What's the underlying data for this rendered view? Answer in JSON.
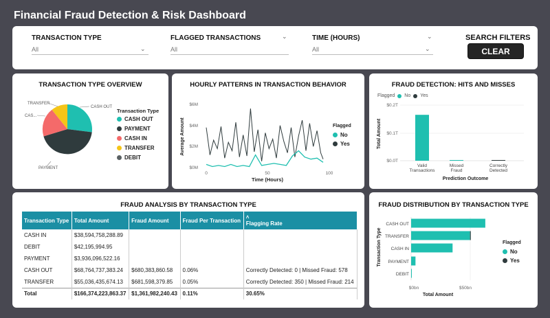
{
  "app_title": "Financial Fraud Detection & Risk Dashboard",
  "filters": {
    "transaction_type": {
      "label": "TRANSACTION TYPE",
      "value": "All"
    },
    "flagged": {
      "label": "FLAGGED TRANSACTIONS",
      "value": "All"
    },
    "time": {
      "label": "TIME (HOURS)",
      "value": "All"
    },
    "search_label": "SEARCH FILTERS",
    "clear_label": "CLEAR"
  },
  "colors": {
    "teal": "#1fbfb0",
    "dark": "#2f3b3d",
    "red": "#f46a6a",
    "yellow": "#f5c518",
    "gray": "#5a6163",
    "header_teal": "#1b8fa4"
  },
  "pie": {
    "title": "TRANSACTION TYPE OVERVIEW",
    "legend_title": "Transaction Type",
    "labels": {
      "cash_out": "CASH OUT",
      "transfer": "TRANSFER",
      "cash_in": "CAS...",
      "payment": "PAYMENT"
    },
    "legend": [
      "CASH OUT",
      "PAYMENT",
      "CASH IN",
      "TRANSFER",
      "DEBIT"
    ]
  },
  "line": {
    "title": "HOURLY PATTERNS IN TRANSACTION BEHAVIOR",
    "xlabel": "Time (Hours)",
    "ylabel": "Average Amount",
    "yticks": [
      "$6M",
      "$4M",
      "$2M",
      "$0M"
    ],
    "xticks": [
      "0",
      "50",
      "100"
    ],
    "legend_title": "Flagged",
    "legend": [
      "No",
      "Yes"
    ]
  },
  "hits": {
    "title": "FRAUD DETECTION: HITS AND MISSES",
    "legend_title": "Flagged",
    "legend": [
      "No",
      "Yes"
    ],
    "ylabel": "Total Amount",
    "yticks": [
      "$0.2T",
      "$0.1T",
      "$0.0T"
    ],
    "xlabel": "Prediction Outcome",
    "categories": [
      "Valid Transactions",
      "Missed Fraud",
      "Correctly Detected"
    ]
  },
  "table": {
    "title": "FRAUD ANALYSIS BY TRANSACTION TYPE",
    "headers": [
      "Transaction Type",
      "Total Amount",
      "Fraud Amount",
      "Fraud Per Transaction",
      "Flagging Rate"
    ],
    "rows": [
      [
        "CASH IN",
        "$38,594,758,288.89",
        "",
        "",
        ""
      ],
      [
        "DEBIT",
        "$42,195,994.95",
        "",
        "",
        ""
      ],
      [
        "PAYMENT",
        "$3,936,096,522.16",
        "",
        "",
        ""
      ],
      [
        "CASH OUT",
        "$68,764,737,383.24",
        "$680,383,860.58",
        "0.06%",
        "Correctly Detected: 0 | Missed Fraud: 578"
      ],
      [
        "TRANSFER",
        "$55,036,435,674.13",
        "$681,598,379.85",
        "0.05%",
        "Correctly Detected: 350 | Missed Fraud: 214"
      ]
    ],
    "total": [
      "Total",
      "$166,374,223,863.37",
      "$1,361,982,240.43",
      "0.11%",
      "30.65%"
    ]
  },
  "dist": {
    "title": "FRAUD DISTRIBUTION BY TRANSACTION TYPE",
    "ylabel": "Transaction Type",
    "xlabel": "Total Amount",
    "xticks": [
      "$0bn",
      "$50bn"
    ],
    "legend_title": "Flagged",
    "legend": [
      "No",
      "Yes"
    ],
    "categories": [
      "CASH OUT",
      "TRANSFER",
      "CASH IN",
      "PAYMENT",
      "DEBIT"
    ]
  },
  "chart_data": [
    {
      "type": "pie",
      "title": "TRANSACTION TYPE OVERVIEW",
      "categories": [
        "CASH OUT",
        "PAYMENT",
        "CASH IN",
        "TRANSFER",
        "DEBIT"
      ],
      "values": [
        35,
        34,
        22,
        9,
        0
      ]
    },
    {
      "type": "line",
      "title": "HOURLY PATTERNS IN TRANSACTION BEHAVIOR",
      "xlabel": "Time (Hours)",
      "ylabel": "Average Amount",
      "xlim": [
        0,
        100
      ],
      "ylim": [
        0,
        6
      ],
      "series": [
        {
          "name": "No",
          "x": [
            0,
            5,
            10,
            15,
            20,
            25,
            30,
            35,
            40,
            45,
            50,
            55,
            60,
            65,
            70,
            75,
            80,
            85,
            90,
            95
          ],
          "y": [
            0.3,
            0.1,
            0.2,
            0.1,
            0.3,
            0.1,
            0.2,
            0.1,
            1.2,
            0.2,
            0.3,
            0.4,
            0.3,
            0.2,
            1.1,
            1.6,
            1.0,
            0.8,
            0.9,
            0.5
          ]
        },
        {
          "name": "Yes",
          "x": [
            0,
            3,
            6,
            9,
            12,
            15,
            18,
            21,
            24,
            27,
            30,
            33,
            36,
            39,
            42,
            45,
            48,
            51,
            54,
            57,
            60,
            63,
            66,
            69,
            72,
            75,
            78,
            81,
            84,
            87,
            90,
            93,
            95
          ],
          "y": [
            3.8,
            1.2,
            2.6,
            1.8,
            3.9,
            0.9,
            2.4,
            1.6,
            4.3,
            1.0,
            3.1,
            1.1,
            5.6,
            1.5,
            3.6,
            0.6,
            3.3,
            1.8,
            2.7,
            0.9,
            4.0,
            2.5,
            1.4,
            3.8,
            1.0,
            3.0,
            4.5,
            1.6,
            4.2,
            2.0,
            3.5,
            1.4,
            0.8
          ]
        }
      ]
    },
    {
      "type": "bar",
      "title": "FRAUD DETECTION: HITS AND MISSES",
      "categories": [
        "Valid Transactions",
        "Missed Fraud",
        "Correctly Detected"
      ],
      "series": [
        {
          "name": "No",
          "values": [
            0.165,
            0.001,
            0
          ]
        },
        {
          "name": "Yes",
          "values": [
            0,
            0,
            0.001
          ]
        }
      ],
      "ylim": [
        0,
        0.2
      ]
    },
    {
      "type": "bar",
      "title": "FRAUD DISTRIBUTION BY TRANSACTION TYPE",
      "categories": [
        "CASH OUT",
        "TRANSFER",
        "CASH IN",
        "PAYMENT",
        "DEBIT"
      ],
      "series": [
        {
          "name": "No",
          "values": [
            68,
            54,
            38,
            4,
            0.04
          ]
        },
        {
          "name": "Yes",
          "values": [
            0,
            0.7,
            0,
            0,
            0
          ]
        }
      ],
      "xlim": [
        0,
        75
      ]
    }
  ]
}
